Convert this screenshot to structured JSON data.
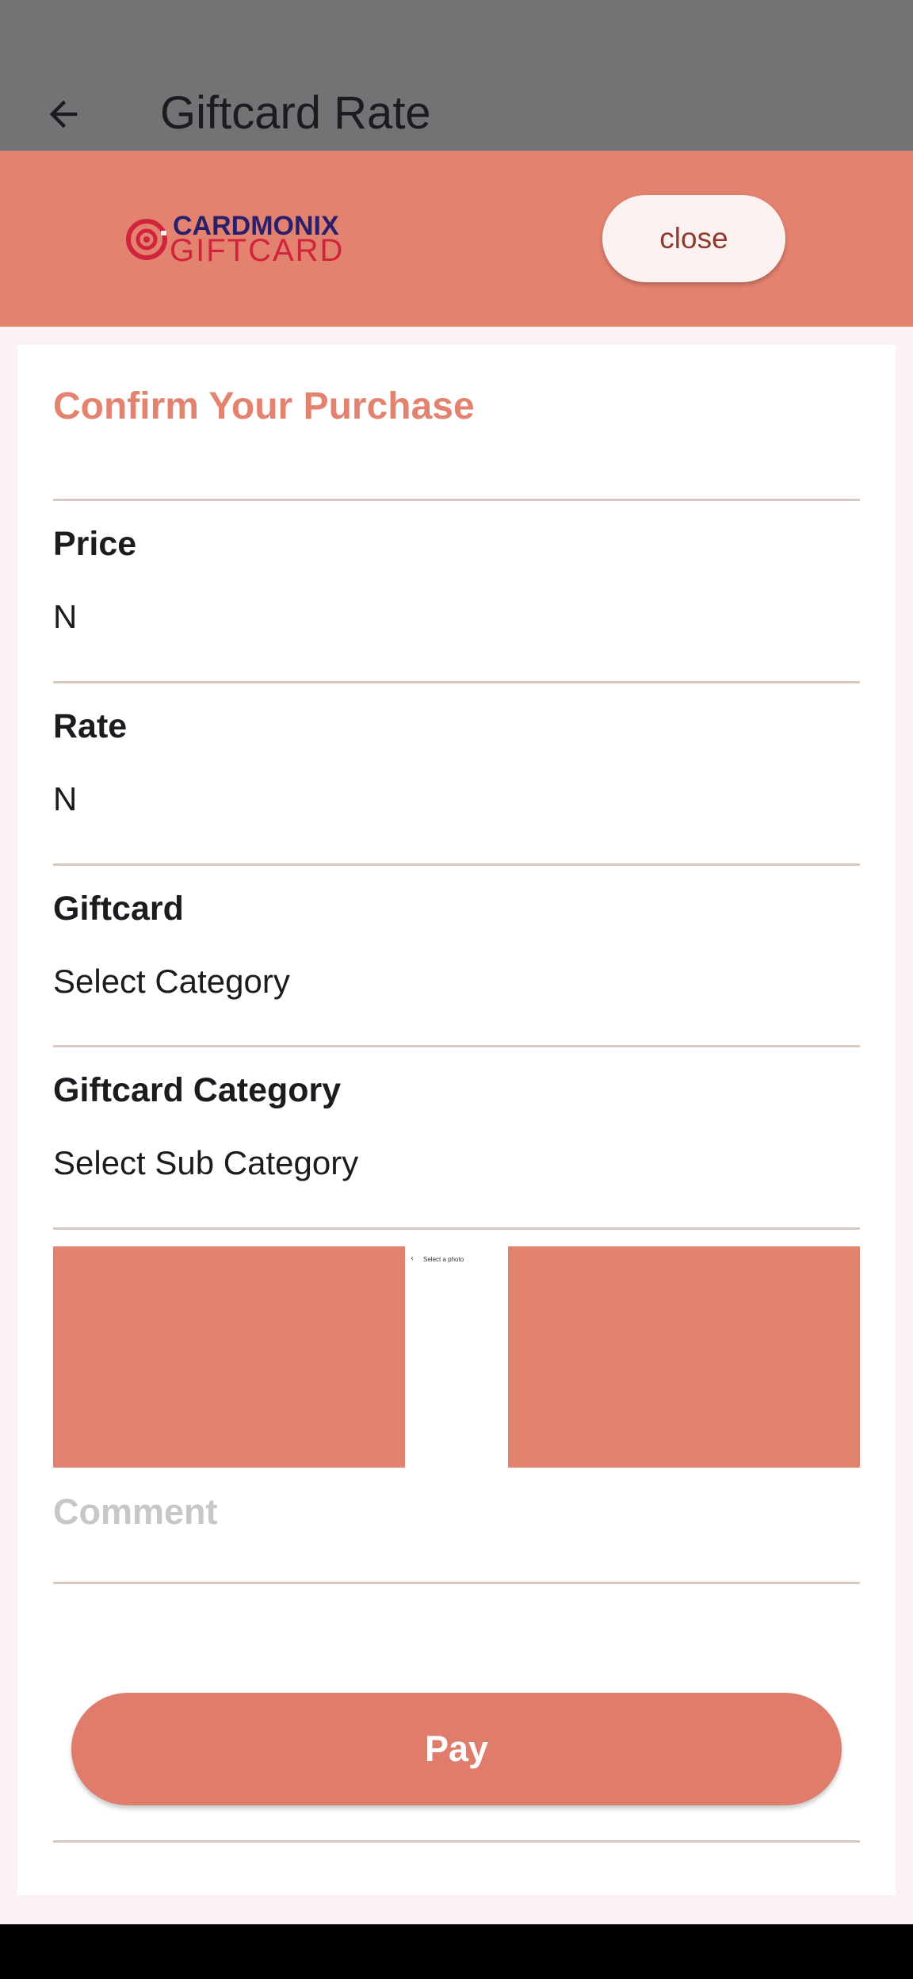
{
  "app_bar": {
    "title": "Giftcard Rate",
    "back_icon": "arrow-left-icon"
  },
  "banner": {
    "logo_text_top": "CARDMONIX",
    "logo_text_bottom": "GIFTCARD",
    "close_label": "close"
  },
  "form": {
    "title": "Confirm Your Purchase",
    "price": {
      "label": "Price",
      "value": "N"
    },
    "rate": {
      "label": "Rate",
      "value": "N"
    },
    "giftcard": {
      "label": "Giftcard",
      "value": "Select Category"
    },
    "category": {
      "label": "Giftcard Category",
      "value": "Select Sub Category"
    },
    "photo_picker": {
      "back_glyph": "‹",
      "text": "Select a photo"
    },
    "comment": {
      "placeholder": "Comment",
      "value": ""
    },
    "pay_label": "Pay"
  },
  "colors": {
    "accent": "#e48270",
    "app_bar": "#737274",
    "background": "#fcf2f3",
    "logo_red": "#d0243d",
    "logo_navy": "#2a1f6b"
  }
}
